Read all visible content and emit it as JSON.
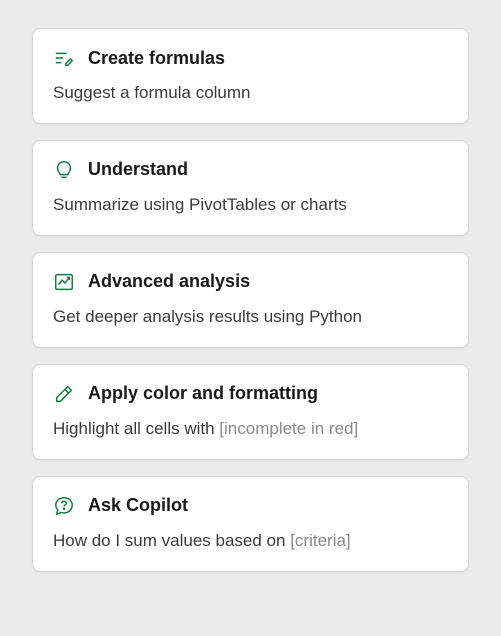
{
  "icon_color": "#107c41",
  "cards": [
    {
      "id": "create-formulas",
      "icon": "formula-pen-icon",
      "title": "Create formulas",
      "description": "Suggest a formula column",
      "placeholder": ""
    },
    {
      "id": "understand",
      "icon": "lightbulb-icon",
      "title": "Understand",
      "description": "Summarize using PivotTables or charts",
      "placeholder": ""
    },
    {
      "id": "advanced-analysis",
      "icon": "chart-line-icon",
      "title": "Advanced analysis",
      "description": "Get deeper analysis results using Python",
      "placeholder": ""
    },
    {
      "id": "apply-formatting",
      "icon": "edit-pen-icon",
      "title": "Apply color and formatting",
      "description": "Highlight all cells with ",
      "placeholder": "[incomplete in red]"
    },
    {
      "id": "ask-copilot",
      "icon": "chat-question-icon",
      "title": "Ask Copilot",
      "description": "How do I sum values based on ",
      "placeholder": "[criteria]"
    }
  ]
}
